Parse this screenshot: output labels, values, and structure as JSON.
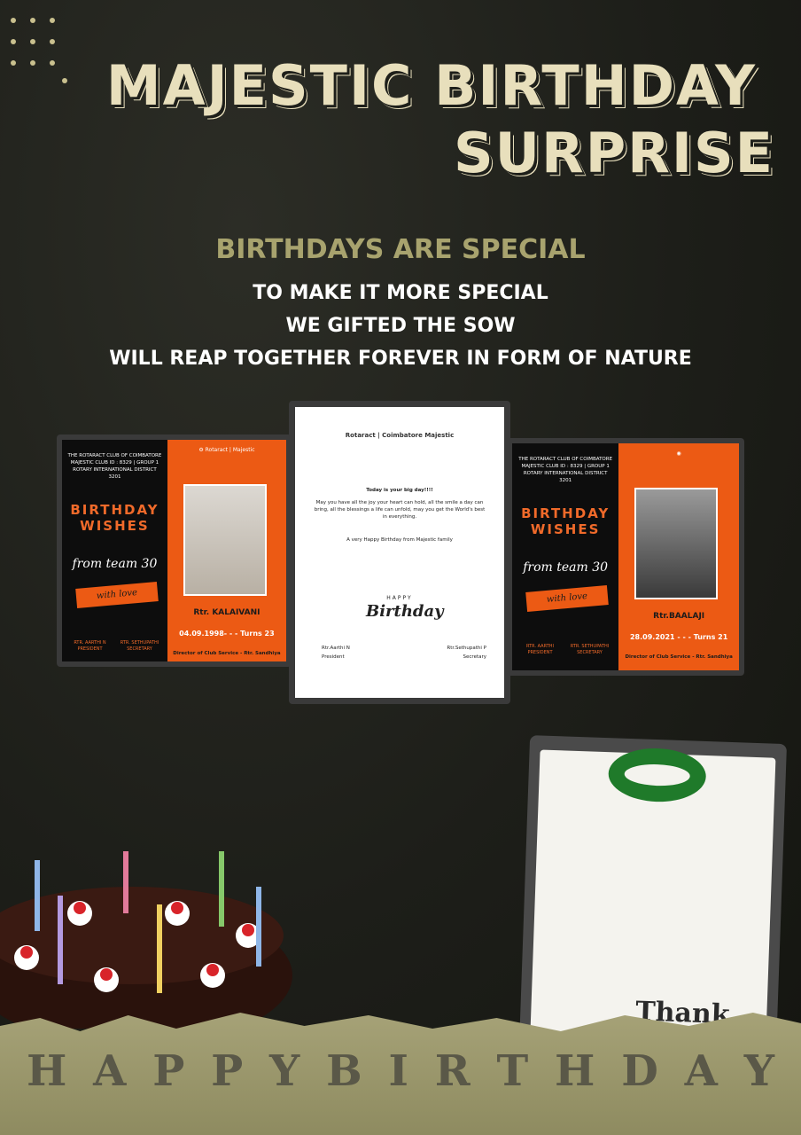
{
  "title": {
    "line1": "MAJESTIC BIRTHDAY",
    "line2": "SURPRISE"
  },
  "subtitle": "BIRTHDAYS ARE SPECIAL",
  "message": [
    "TO MAKE IT MORE SPECIAL",
    "WE GIFTED THE SOW",
    "WILL REAP TOGETHER FOREVER IN FORM OF NATURE"
  ],
  "card_left": {
    "club": "THE ROTARACT CLUB OF COIMBATORE MAJESTIC CLUB ID : 8329 | GROUP 1 ROTARY INTERNATIONAL DISTRICT 3201",
    "heading": "BIRTHDAY WISHES",
    "from": "from team 30",
    "with_love": "with love",
    "president": "RTR. AARTHI N PRESIDENT",
    "secretary": "RTR. SETHUPATHI SECRETARY",
    "name": "Rtr. KALAIVANI",
    "date": "04.09.1998- - - Turns 23",
    "director": "Director of Club Service - Rtr. Sandhiya"
  },
  "card_mid": {
    "logo": "Rotaract | Coimbatore Majestic",
    "greeting": "Today is your big day!!!!",
    "body": "May you have all the joy your heart can hold, all the smile a day can bring, all the blessings a life can unfold, may you get the World's best in everything.",
    "closing": "A very Happy Birthday from Majestic family",
    "hb": "Birthday",
    "happy": "HAPPY",
    "president_name": "Rtr.Aarthi N",
    "president_label": "President",
    "secretary_name": "Rtr.Sethupathi P",
    "secretary_label": "Secretary"
  },
  "card_right": {
    "club": "THE ROTARACT CLUB OF COIMBATORE MAJESTIC CLUB ID : 8329 | GROUP 1 ROTARY INTERNATIONAL DISTRICT 3201",
    "heading": "BIRTHDAY WISHES",
    "from": "from team 30",
    "with_love": "with love",
    "president": "RTR. AARTHI PRESIDENT",
    "secretary": "RTR. SETHUPATHI SECRETARY",
    "name": "Rtr.BAALAJI",
    "date": "28.09.2021 - - - Turns 21",
    "director": "Director of Club Service - Rtr. Sandhiya"
  },
  "gift_text": "Thank You",
  "banner_letters": [
    "H",
    "A",
    "P",
    "P",
    "Y",
    "B",
    "I",
    "R",
    "T",
    "H",
    "D",
    "A",
    "Y"
  ]
}
